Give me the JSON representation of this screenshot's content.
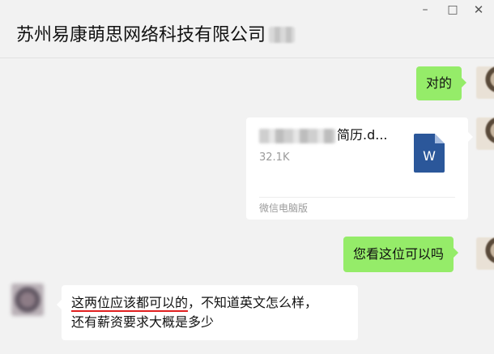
{
  "window": {
    "controls": {
      "minimize": "–",
      "maximize": "□",
      "close": "✕"
    }
  },
  "chat": {
    "title": "苏州易康萌思网络科技有限公司"
  },
  "messages": [
    {
      "side": "right",
      "type": "text",
      "text": "对的"
    },
    {
      "side": "right",
      "type": "file",
      "file_name": "简历.d...",
      "file_size": "32.1K",
      "file_icon": "word-icon",
      "file_icon_letter": "W",
      "source": "微信电脑版"
    },
    {
      "side": "right",
      "type": "text",
      "text": "您看这位可以吗"
    },
    {
      "side": "left",
      "type": "text",
      "line1_underlined": "这两位应该都可以的",
      "line1_rest": "，不知道英文怎么样，",
      "line2": "还有薪资要求大概是多少"
    }
  ],
  "colors": {
    "background": "#f2f2f2",
    "own_bubble": "#95ec69",
    "other_bubble": "#ffffff",
    "word_blue": "#2b579a",
    "annotation_red": "#e02020"
  }
}
